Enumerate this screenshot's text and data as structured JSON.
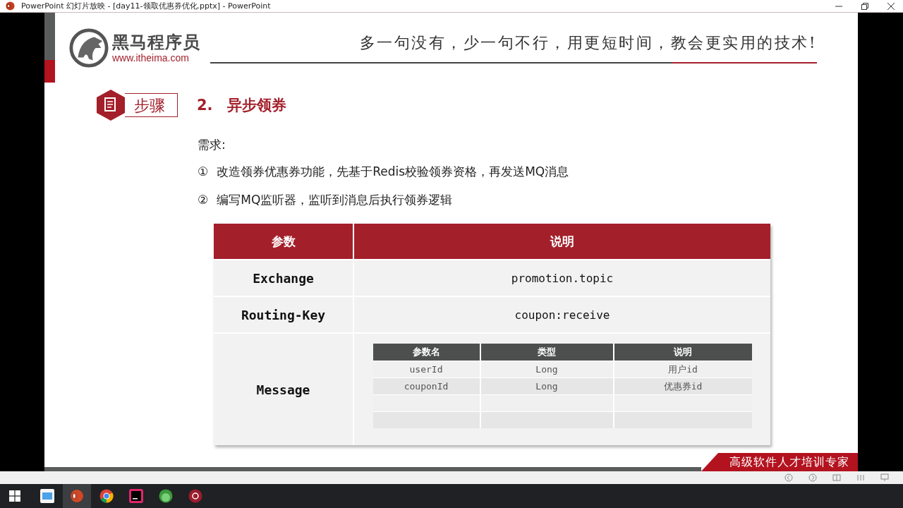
{
  "window": {
    "title": "PowerPoint 幻灯片放映 - [day11-领取优惠券优化.pptx] - PowerPoint"
  },
  "slide": {
    "logo": {
      "name": "黑马程序员",
      "url": "www.itheima.com"
    },
    "slogan": "多一句没有，少一句不行，用更短时间，教会更实用的技术!",
    "step_badge": "步骤",
    "heading_number": "2.",
    "heading": "异步领券",
    "requirement_label": "需求:",
    "requirements": [
      {
        "marker": "①",
        "text": "改造领券优惠券功能，先基于Redis校验领券资格，再发送MQ消息"
      },
      {
        "marker": "②",
        "text": "编写MQ监听器，监听到消息后执行领券逻辑"
      }
    ],
    "table": {
      "columns": [
        "参数",
        "说明"
      ],
      "rows": [
        {
          "kind": "text",
          "param": "Exchange",
          "value": "promotion.topic"
        },
        {
          "kind": "text",
          "param": "Routing-Key",
          "value": "coupon:receive"
        },
        {
          "kind": "table",
          "param": "Message",
          "columns": [
            "参数名",
            "类型",
            "说明"
          ],
          "rows": [
            {
              "kind": "data",
              "cells": [
                "userId",
                "Long",
                "用户id"
              ]
            },
            {
              "kind": "data",
              "cells": [
                "couponId",
                "Long",
                "优惠券id"
              ]
            },
            {
              "kind": "blank"
            },
            {
              "kind": "blank"
            }
          ]
        }
      ]
    },
    "footer_banner": "高级软件人才培训专家"
  }
}
